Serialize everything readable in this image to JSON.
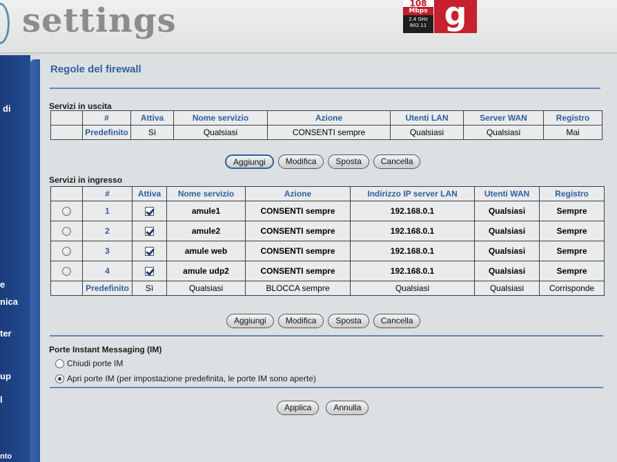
{
  "header": {
    "title": "settings",
    "badge_speed": "108",
    "badge_unit": "Mbps",
    "badge_freq": "2.4 GHz",
    "badge_std": "802.11",
    "badge_letter": "g"
  },
  "sidebar": {
    "items": [
      "di",
      "e",
      "nica",
      "ter",
      "up",
      "l",
      "nto"
    ]
  },
  "page": {
    "title": "Regole del firewall"
  },
  "outbound": {
    "label": "Servizi in uscita",
    "headers": [
      "",
      "#",
      "Attiva",
      "Nome servizio",
      "Azione",
      "Utenti LAN",
      "Server WAN",
      "Registro"
    ],
    "default_row": [
      "",
      "Predefinito",
      "Sì",
      "Qualsiasi",
      "CONSENTI sempre",
      "Qualsiasi",
      "Qualsiasi",
      "Mai"
    ],
    "buttons": [
      "Aggiungi",
      "Modifica",
      "Sposta",
      "Cancella"
    ]
  },
  "inbound": {
    "label": "Servizi in ingresso",
    "headers": [
      "",
      "#",
      "Attiva",
      "Nome servizio",
      "Azione",
      "Indirizzo IP server LAN",
      "Utenti WAN",
      "Registro"
    ],
    "rows": [
      {
        "num": "1",
        "name": "amule1",
        "action": "CONSENTI sempre",
        "ip": "192.168.0.1",
        "wan": "Qualsiasi",
        "log": "Sempre"
      },
      {
        "num": "2",
        "name": "amule2",
        "action": "CONSENTI sempre",
        "ip": "192.168.0.1",
        "wan": "Qualsiasi",
        "log": "Sempre"
      },
      {
        "num": "3",
        "name": "amule web",
        "action": "CONSENTI sempre",
        "ip": "192.168.0.1",
        "wan": "Qualsiasi",
        "log": "Sempre"
      },
      {
        "num": "4",
        "name": "amule udp2",
        "action": "CONSENTI sempre",
        "ip": "192.168.0.1",
        "wan": "Qualsiasi",
        "log": "Sempre"
      }
    ],
    "default_row": [
      "",
      "Predefinito",
      "Sì",
      "Qualsiasi",
      "BLOCCA sempre",
      "Qualsiasi",
      "Qualsiasi",
      "Corrisponde"
    ],
    "buttons": [
      "Aggiungi",
      "Modifica",
      "Sposta",
      "Cancella"
    ]
  },
  "im": {
    "label": "Porte Instant Messaging (IM)",
    "options": [
      {
        "label": "Chiudi porte IM",
        "selected": false
      },
      {
        "label": "Apri porte IM (per impostazione predefinita, le porte IM sono aperte)",
        "selected": true
      }
    ]
  },
  "footer": {
    "apply": "Applica",
    "cancel": "Annulla"
  },
  "colors": {
    "accent": "#2f5ea0",
    "sidebar": "#1b3c7c",
    "brand_red": "#c8202c"
  }
}
